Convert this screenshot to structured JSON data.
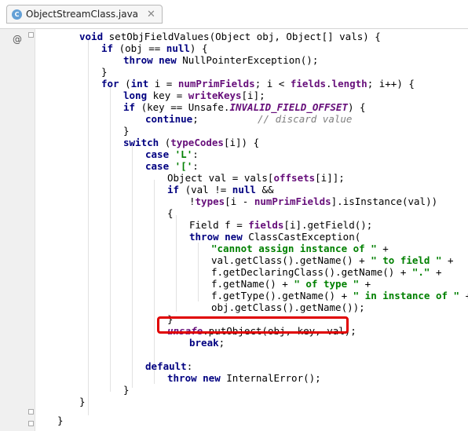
{
  "tab": {
    "label": "ObjectStreamClass.java",
    "icon": "java-class-icon"
  },
  "gutter": {
    "override_marker": "@"
  },
  "lines": [
    [
      [
        "void ",
        "kw"
      ],
      [
        "setObjFieldValues(Object obj, Object[] vals) {",
        ""
      ]
    ],
    [
      [
        "if ",
        "kw"
      ],
      [
        "(obj == ",
        ""
      ],
      [
        "null",
        "kw"
      ],
      [
        ") {",
        ""
      ]
    ],
    [
      [
        "throw new ",
        "kw"
      ],
      [
        "NullPointerException();",
        ""
      ]
    ],
    [
      [
        "}",
        ""
      ]
    ],
    [
      [
        "for ",
        "kw"
      ],
      [
        "(",
        ""
      ],
      [
        "int ",
        "kw"
      ],
      [
        "i = ",
        ""
      ],
      [
        "numPrimFields",
        "fld"
      ],
      [
        "; i < ",
        ""
      ],
      [
        "fields",
        "fld"
      ],
      [
        ".",
        ""
      ],
      [
        "length",
        "fld"
      ],
      [
        "; i++) {",
        ""
      ]
    ],
    [
      [
        "long ",
        "kw"
      ],
      [
        "key = ",
        ""
      ],
      [
        "writeKeys",
        "fld"
      ],
      [
        "[i];",
        ""
      ]
    ],
    [
      [
        "if ",
        "kw"
      ],
      [
        "(key == Unsafe.",
        ""
      ],
      [
        "INVALID_FIELD_OFFSET",
        "sfld"
      ],
      [
        ") {",
        ""
      ]
    ],
    [
      [
        "continue",
        "kw"
      ],
      [
        ";          ",
        ""
      ],
      [
        "// discard value",
        "cmt"
      ]
    ],
    [
      [
        "}",
        ""
      ]
    ],
    [
      [
        "switch ",
        "kw"
      ],
      [
        "(",
        ""
      ],
      [
        "typeCodes",
        "fld"
      ],
      [
        "[i]) {",
        ""
      ]
    ],
    [
      [
        "case ",
        "kw"
      ],
      [
        "'L'",
        "str"
      ],
      [
        ":",
        ""
      ]
    ],
    [
      [
        "case ",
        "kw"
      ],
      [
        "'['",
        "str"
      ],
      [
        ":",
        ""
      ]
    ],
    [
      [
        "Object val = vals[",
        ""
      ],
      [
        "offsets",
        "fld"
      ],
      [
        "[i]];",
        ""
      ]
    ],
    [
      [
        "if ",
        "kw"
      ],
      [
        "(val != ",
        ""
      ],
      [
        "null ",
        "kw"
      ],
      [
        "&&",
        ""
      ]
    ],
    [
      [
        "!",
        ""
      ],
      [
        "types",
        "fld"
      ],
      [
        "[i - ",
        ""
      ],
      [
        "numPrimFields",
        "fld"
      ],
      [
        "].isInstance(val))",
        ""
      ]
    ],
    [
      [
        "{",
        ""
      ]
    ],
    [
      [
        "Field f = ",
        ""
      ],
      [
        "fields",
        "fld"
      ],
      [
        "[i].getField();",
        ""
      ]
    ],
    [
      [
        "throw new ",
        "kw"
      ],
      [
        "ClassCastException(",
        ""
      ]
    ],
    [
      [
        "\"cannot assign instance of \"",
        "str"
      ],
      [
        " +",
        ""
      ]
    ],
    [
      [
        "val.getClass().getName() + ",
        ""
      ],
      [
        "\" to field \"",
        "str"
      ],
      [
        " +",
        ""
      ]
    ],
    [
      [
        "f.getDeclaringClass().getName() + ",
        ""
      ],
      [
        "\".\"",
        "str"
      ],
      [
        " +",
        ""
      ]
    ],
    [
      [
        "f.getName() + ",
        ""
      ],
      [
        "\" of type \"",
        "str"
      ],
      [
        " +",
        ""
      ]
    ],
    [
      [
        "f.getType().getName() + ",
        ""
      ],
      [
        "\" in instance of \"",
        "str"
      ],
      [
        " +",
        ""
      ]
    ],
    [
      [
        "obj.getClass().getName());",
        ""
      ]
    ],
    [
      [
        "}",
        ""
      ]
    ],
    [
      [
        "unsafe",
        "sfld"
      ],
      [
        ".putObject(obj, key, val);",
        ""
      ]
    ],
    [
      [
        "break",
        "kw"
      ],
      [
        ";",
        ""
      ]
    ],
    [
      [
        "",
        ""
      ]
    ],
    [
      [
        "default",
        "kw"
      ],
      [
        ":",
        ""
      ]
    ],
    [
      [
        "throw new ",
        "kw"
      ],
      [
        "InternalError();",
        ""
      ]
    ],
    [
      [
        "}",
        ""
      ]
    ],
    [
      [
        "}",
        ""
      ]
    ],
    [
      [
        "}",
        ""
      ]
    ]
  ]
}
